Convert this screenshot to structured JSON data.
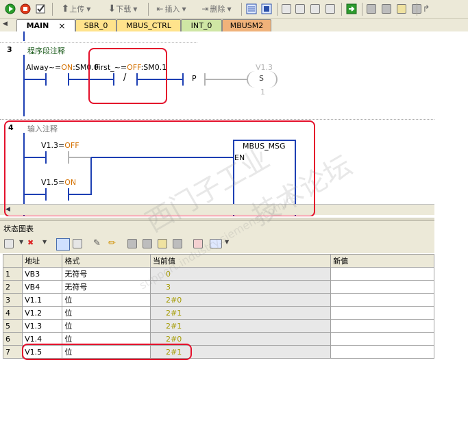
{
  "toolbar": {
    "upload": "上传",
    "download": "下载",
    "insert": "插入",
    "delete": "删除"
  },
  "tabs": [
    "MAIN",
    "SBR_0",
    "MBUS_CTRL",
    "INT_0",
    "MBUSM2"
  ],
  "tab_close": "×",
  "network3": {
    "num": "3",
    "comment": "程序段注释",
    "contact1_label": "Alway~=",
    "contact1_value": "ON",
    "contact1_addr": ":SM0.0",
    "contact2_label": "First_~=",
    "contact2_value": "OFF",
    "contact2_addr": ":SM0.1",
    "not_symbol": "/",
    "p_symbol": "P",
    "coil_addr": "V1.3",
    "coil_type": "S",
    "coil_n": "1"
  },
  "network4": {
    "num": "4",
    "comment": "输入注释",
    "contact1_label": "V1.3=",
    "contact1_value": "OFF",
    "contact2_label": "V1.5=",
    "contact2_value": "ON",
    "block_title": "MBUS_MSG",
    "block_en": "EN"
  },
  "status_chart": {
    "title": "状态图表",
    "headers": [
      "",
      "地址",
      "格式",
      "当前值",
      "新值"
    ],
    "rows": [
      [
        "1",
        "VB3",
        "无符号",
        "0",
        ""
      ],
      [
        "2",
        "VB4",
        "无符号",
        "3",
        ""
      ],
      [
        "3",
        "V1.1",
        "位",
        "2#0",
        ""
      ],
      [
        "4",
        "V1.2",
        "位",
        "2#1",
        ""
      ],
      [
        "5",
        "V1.3",
        "位",
        "2#1",
        ""
      ],
      [
        "6",
        "V1.4",
        "位",
        "2#0",
        ""
      ],
      [
        "7",
        "V1.5",
        "位",
        "2#1",
        ""
      ]
    ]
  },
  "watermark": {
    "line1": "西门子工业",
    "line2": "技术论坛",
    "url": "support.industry.siemens.com/cs"
  },
  "colors": {
    "accent": "#1d3fb3",
    "highlight": "#e4102b",
    "value": "#a49a00",
    "on": "#d47000"
  }
}
